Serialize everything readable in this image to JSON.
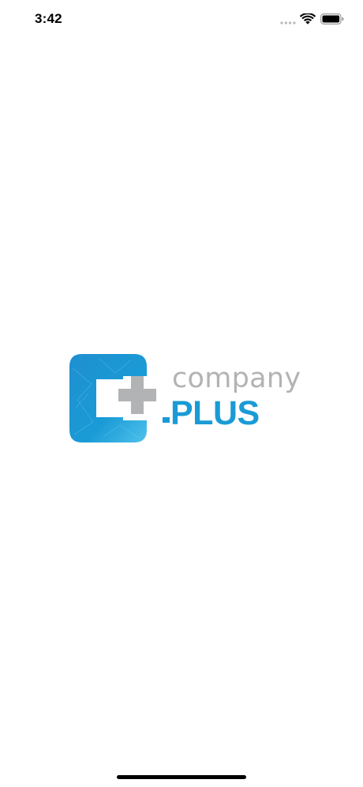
{
  "status_bar": {
    "time": "3:42",
    "icons": [
      "cellular-signal-icon",
      "wifi-icon",
      "battery-icon"
    ]
  },
  "logo": {
    "word_top": "company",
    "word_bottom": "PLUS",
    "colors": {
      "brand_blue": "#1a9bd6",
      "brand_gray": "#b2b3b5"
    }
  }
}
